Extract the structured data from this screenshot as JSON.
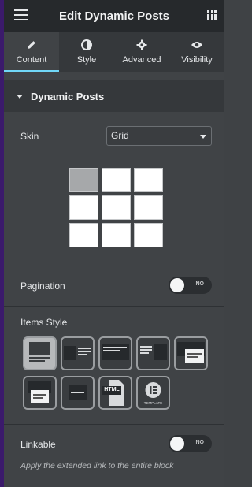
{
  "header": {
    "title": "Edit Dynamic Posts",
    "menu_icon": "hamburger-icon",
    "apps_icon": "grid-icon"
  },
  "tabs": [
    {
      "label": "Content",
      "icon": "pencil-icon",
      "active": true
    },
    {
      "label": "Style",
      "icon": "contrast-icon",
      "active": false
    },
    {
      "label": "Advanced",
      "icon": "gear-icon",
      "active": false
    },
    {
      "label": "Visibility",
      "icon": "eye-icon",
      "active": false
    }
  ],
  "section": {
    "title": "Dynamic Posts"
  },
  "skin": {
    "label": "Skin",
    "value": "Grid",
    "layout_selected": 1,
    "layout_count": 9
  },
  "pagination": {
    "label": "Pagination",
    "toggle_text": "NO",
    "on": false
  },
  "items_style": {
    "label": "Items Style",
    "selected": 1,
    "html_badge": "HTML",
    "template_caption": "TEMPLATE"
  },
  "linkable": {
    "label": "Linkable",
    "toggle_text": "NO",
    "on": false,
    "hint": "Apply the extended link to the entire block"
  },
  "colors": {
    "accent": "#71d7f7",
    "panel": "#404346",
    "header": "#26292c"
  }
}
